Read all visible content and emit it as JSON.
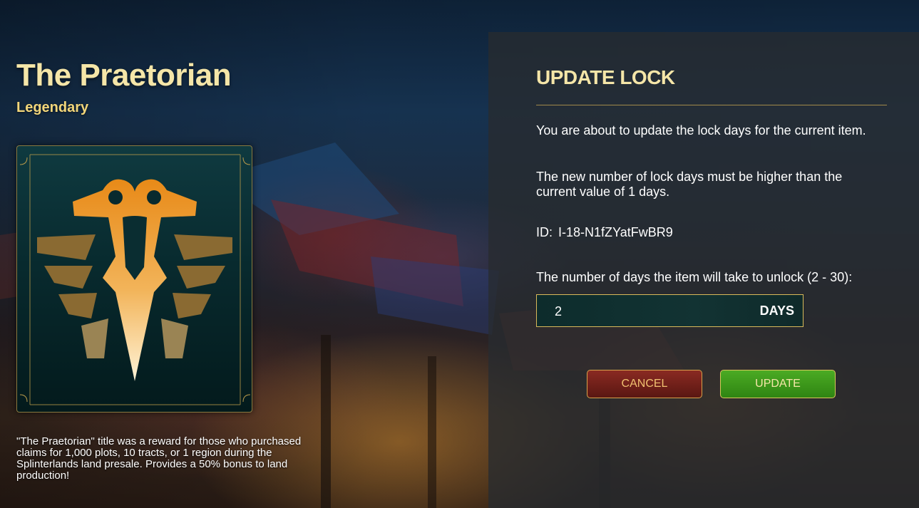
{
  "item": {
    "title": "The Praetorian",
    "rarity": "Legendary",
    "description": "\"The Praetorian\" title was a reward for those who purchased claims for 1,000 plots, 10 tracts, or 1 region during the Splinterlands land presale. Provides a 50% bonus to land production!",
    "emblem_icon": "praetorian-eagle-icon"
  },
  "dialog": {
    "title": "UPDATE LOCK",
    "intro": "You are about to update the lock days for the current item.",
    "rule": "The new number of lock days must be higher than the current value of 1 days.",
    "id_label": "ID:",
    "id_value": "I-18-N1fZYatFwBR9",
    "days_label": "The number of days the item will take to unlock (2 - 30):",
    "days_value": "2",
    "days_unit": "DAYS",
    "cancel_label": "CANCEL",
    "update_label": "UPDATE"
  },
  "colors": {
    "accent_gold": "#f5e6a8",
    "rarity_gold": "#f2d67a",
    "cancel_red": "#7a2219",
    "update_green": "#3e9a1c"
  }
}
